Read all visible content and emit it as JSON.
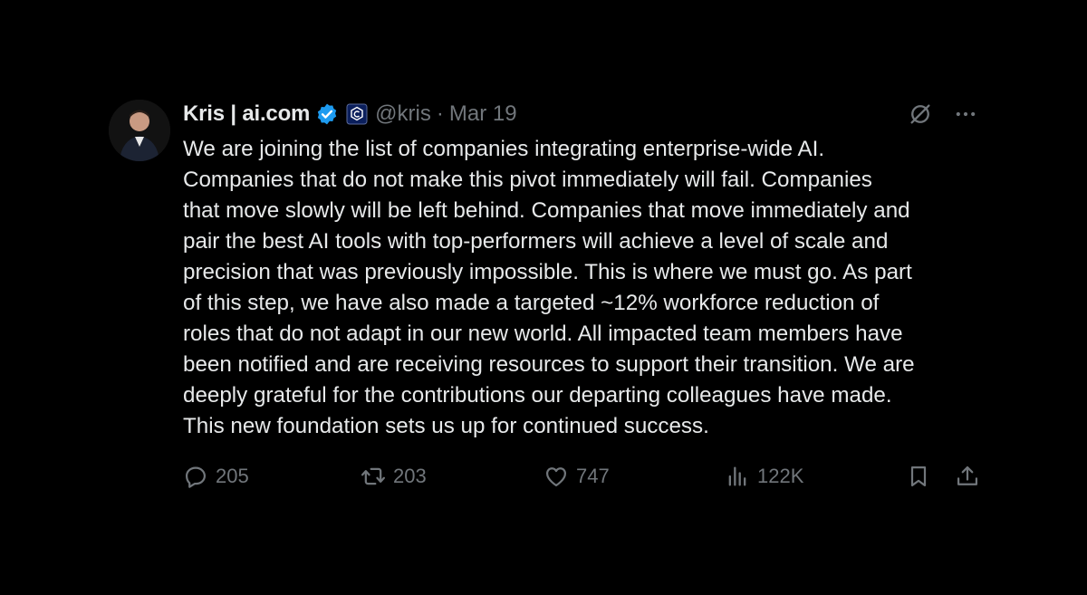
{
  "author": {
    "name": "Kris | ai.com",
    "handle": "@kris",
    "separator": "·",
    "date": "Mar 19",
    "verified_color": "#1d9bf0",
    "affiliate_badge_color": "#0b1f5c"
  },
  "tweet": {
    "text": "We are joining the list of companies integrating enterprise-wide AI.\nCompanies that do not make this pivot immediately will fail. Companies\nthat move slowly will be left behind. Companies that move immediately and\npair the best AI tools with top-performers will achieve a level of scale and\nprecision that was previously impossible. This is where we must go. As part\nof this step, we have also made a targeted ~12% workforce reduction of\nroles that do not adapt in our new world. All impacted team members have\nbeen notified and are receiving resources to support their transition. We are\ndeeply grateful for the contributions our departing colleagues have made.\nThis new foundation sets us up for continued success."
  },
  "metrics": {
    "replies": "205",
    "retweets": "203",
    "likes": "747",
    "views": "122K"
  },
  "icons": {
    "reply": "reply-icon",
    "retweet": "retweet-icon",
    "like": "heart-icon",
    "views": "views-icon",
    "bookmark": "bookmark-icon",
    "share": "share-icon",
    "grok": "grok-icon",
    "more": "more-icon"
  },
  "colors": {
    "background": "#000000",
    "text": "#e7e9ea",
    "muted": "#71767b"
  }
}
